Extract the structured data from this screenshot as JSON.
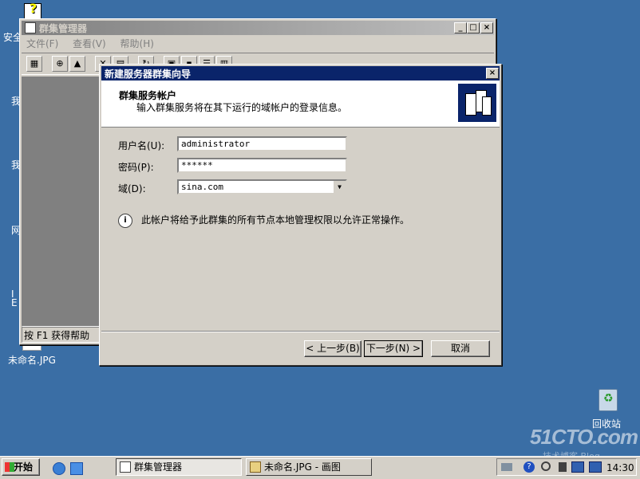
{
  "desktop": {
    "left_labels": [
      "安全",
      "我",
      "我",
      "网",
      "I\nE",
      "未命名.JPG"
    ],
    "recycle_bin_label": "回收站",
    "watermark": "51CTO.com",
    "watermark_sub": "技术博客 Blog"
  },
  "cluster_window": {
    "title": "群集管理器",
    "menu": [
      "文件(F)",
      "查看(V)",
      "帮助(H)"
    ],
    "status_text": "按 F1 获得帮助"
  },
  "wizard": {
    "title": "新建服务器群集向导",
    "header_title": "群集服务帐户",
    "header_subtitle": "输入群集服务将在其下运行的域帐户的登录信息。",
    "username_label": "用户名(U):",
    "username_value": "administrator",
    "password_label": "密码(P):",
    "password_value": "******",
    "domain_label": "域(D):",
    "domain_value": "sina.com",
    "info_text": "此帐户将给予此群集的所有节点本地管理权限以允许正常操作。",
    "back_button": "< 上一步(B)",
    "next_button": "下一步(N) >",
    "cancel_button": "取消"
  },
  "taskbar": {
    "start_label": "开始",
    "tasks": [
      "群集管理器",
      "未命名.JPG - 画图"
    ],
    "clock": "14:30"
  }
}
